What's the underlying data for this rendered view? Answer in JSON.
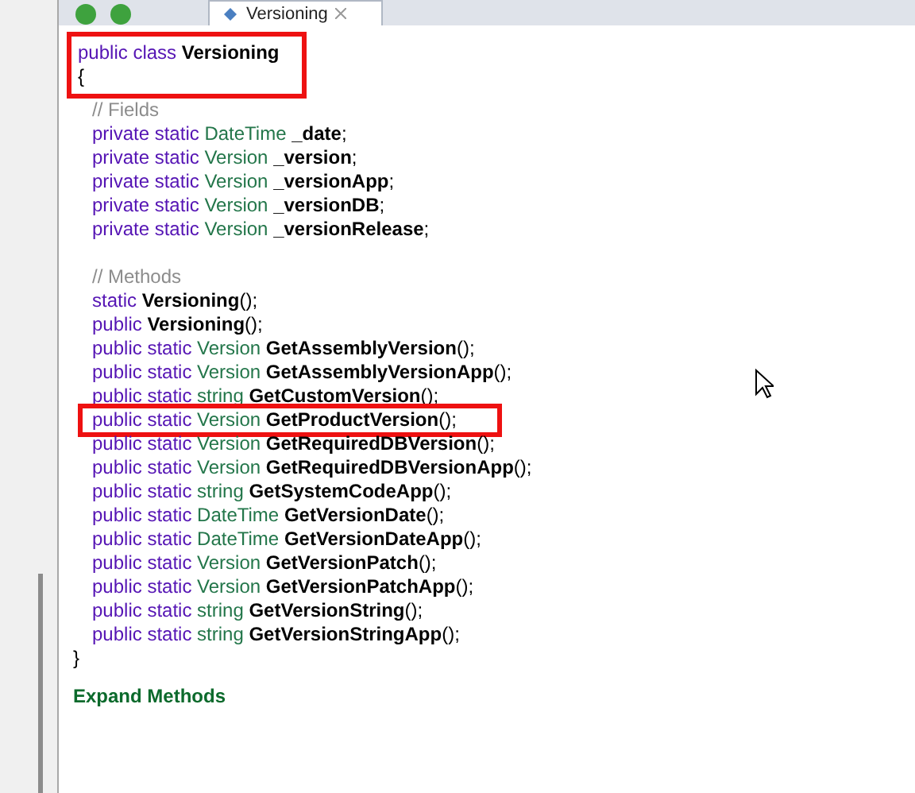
{
  "toolbar": {
    "tab": {
      "label": "Versioning",
      "selected": true
    }
  },
  "header": {
    "highlighted": true,
    "lines": [
      [
        {
          "kind": "keyword",
          "text": "public class "
        },
        {
          "kind": "name",
          "text": "Versioning"
        }
      ],
      [
        {
          "kind": "plain",
          "text": "{"
        }
      ]
    ]
  },
  "sections": [
    {
      "lines": [
        {
          "highlighted": false,
          "segments": [
            {
              "kind": "comment",
              "text": "// Fields"
            }
          ]
        },
        {
          "highlighted": false,
          "segments": [
            {
              "kind": "keyword",
              "text": "private static "
            },
            {
              "kind": "type",
              "text": "DateTime "
            },
            {
              "kind": "name",
              "text": "_date"
            },
            {
              "kind": "plain",
              "text": ";"
            }
          ]
        },
        {
          "highlighted": false,
          "segments": [
            {
              "kind": "keyword",
              "text": "private static "
            },
            {
              "kind": "type",
              "text": "Version "
            },
            {
              "kind": "name",
              "text": "_version"
            },
            {
              "kind": "plain",
              "text": ";"
            }
          ]
        },
        {
          "highlighted": false,
          "segments": [
            {
              "kind": "keyword",
              "text": "private static "
            },
            {
              "kind": "type",
              "text": "Version "
            },
            {
              "kind": "name",
              "text": "_versionApp"
            },
            {
              "kind": "plain",
              "text": ";"
            }
          ]
        },
        {
          "highlighted": false,
          "segments": [
            {
              "kind": "keyword",
              "text": "private static "
            },
            {
              "kind": "type",
              "text": "Version "
            },
            {
              "kind": "name",
              "text": "_versionDB"
            },
            {
              "kind": "plain",
              "text": ";"
            }
          ]
        },
        {
          "highlighted": false,
          "segments": [
            {
              "kind": "keyword",
              "text": "private static "
            },
            {
              "kind": "type",
              "text": "Version "
            },
            {
              "kind": "name",
              "text": "_versionRelease"
            },
            {
              "kind": "plain",
              "text": ";"
            }
          ]
        }
      ]
    },
    {
      "lines": [
        {
          "highlighted": false,
          "segments": [
            {
              "kind": "comment",
              "text": "// Methods"
            }
          ]
        },
        {
          "highlighted": false,
          "segments": [
            {
              "kind": "keyword",
              "text": "static "
            },
            {
              "kind": "name",
              "text": "Versioning"
            },
            {
              "kind": "plain",
              "text": "();"
            }
          ]
        },
        {
          "highlighted": false,
          "segments": [
            {
              "kind": "keyword",
              "text": "public "
            },
            {
              "kind": "name",
              "text": "Versioning"
            },
            {
              "kind": "plain",
              "text": "();"
            }
          ]
        },
        {
          "highlighted": false,
          "segments": [
            {
              "kind": "keyword",
              "text": "public static "
            },
            {
              "kind": "type",
              "text": "Version "
            },
            {
              "kind": "name",
              "text": "GetAssemblyVersion"
            },
            {
              "kind": "plain",
              "text": "();"
            }
          ]
        },
        {
          "highlighted": false,
          "segments": [
            {
              "kind": "keyword",
              "text": "public static "
            },
            {
              "kind": "type",
              "text": "Version "
            },
            {
              "kind": "name",
              "text": "GetAssemblyVersionApp"
            },
            {
              "kind": "plain",
              "text": "();"
            }
          ]
        },
        {
          "highlighted": false,
          "segments": [
            {
              "kind": "keyword",
              "text": "public static "
            },
            {
              "kind": "type",
              "text": "string "
            },
            {
              "kind": "name",
              "text": "GetCustomVersion"
            },
            {
              "kind": "plain",
              "text": "();"
            }
          ]
        },
        {
          "highlighted": true,
          "segments": [
            {
              "kind": "keyword",
              "text": "public static "
            },
            {
              "kind": "type",
              "text": "Version "
            },
            {
              "kind": "name",
              "text": "GetProductVersion"
            },
            {
              "kind": "plain",
              "text": "();"
            }
          ]
        },
        {
          "highlighted": false,
          "segments": [
            {
              "kind": "keyword",
              "text": "public static "
            },
            {
              "kind": "type",
              "text": "Version "
            },
            {
              "kind": "name",
              "text": "GetRequiredDBVersion"
            },
            {
              "kind": "plain",
              "text": "();"
            }
          ]
        },
        {
          "highlighted": false,
          "segments": [
            {
              "kind": "keyword",
              "text": "public static "
            },
            {
              "kind": "type",
              "text": "Version "
            },
            {
              "kind": "name",
              "text": "GetRequiredDBVersionApp"
            },
            {
              "kind": "plain",
              "text": "();"
            }
          ]
        },
        {
          "highlighted": false,
          "segments": [
            {
              "kind": "keyword",
              "text": "public static "
            },
            {
              "kind": "type",
              "text": "string "
            },
            {
              "kind": "name",
              "text": "GetSystemCodeApp"
            },
            {
              "kind": "plain",
              "text": "();"
            }
          ]
        },
        {
          "highlighted": false,
          "segments": [
            {
              "kind": "keyword",
              "text": "public static "
            },
            {
              "kind": "type",
              "text": "DateTime "
            },
            {
              "kind": "name",
              "text": "GetVersionDate"
            },
            {
              "kind": "plain",
              "text": "();"
            }
          ]
        },
        {
          "highlighted": false,
          "segments": [
            {
              "kind": "keyword",
              "text": "public static "
            },
            {
              "kind": "type",
              "text": "DateTime "
            },
            {
              "kind": "name",
              "text": "GetVersionDateApp"
            },
            {
              "kind": "plain",
              "text": "();"
            }
          ]
        },
        {
          "highlighted": false,
          "segments": [
            {
              "kind": "keyword",
              "text": "public static "
            },
            {
              "kind": "type",
              "text": "Version "
            },
            {
              "kind": "name",
              "text": "GetVersionPatch"
            },
            {
              "kind": "plain",
              "text": "();"
            }
          ]
        },
        {
          "highlighted": false,
          "segments": [
            {
              "kind": "keyword",
              "text": "public static "
            },
            {
              "kind": "type",
              "text": "Version "
            },
            {
              "kind": "name",
              "text": "GetVersionPatchApp"
            },
            {
              "kind": "plain",
              "text": "();"
            }
          ]
        },
        {
          "highlighted": false,
          "segments": [
            {
              "kind": "keyword",
              "text": "public static "
            },
            {
              "kind": "type",
              "text": "string "
            },
            {
              "kind": "name",
              "text": "GetVersionString"
            },
            {
              "kind": "plain",
              "text": "();"
            }
          ]
        },
        {
          "highlighted": false,
          "segments": [
            {
              "kind": "keyword",
              "text": "public static "
            },
            {
              "kind": "type",
              "text": "string "
            },
            {
              "kind": "name",
              "text": "GetVersionStringApp"
            },
            {
              "kind": "plain",
              "text": "();"
            }
          ]
        }
      ]
    }
  ],
  "closing": "}",
  "expand_link": "Expand Methods"
}
